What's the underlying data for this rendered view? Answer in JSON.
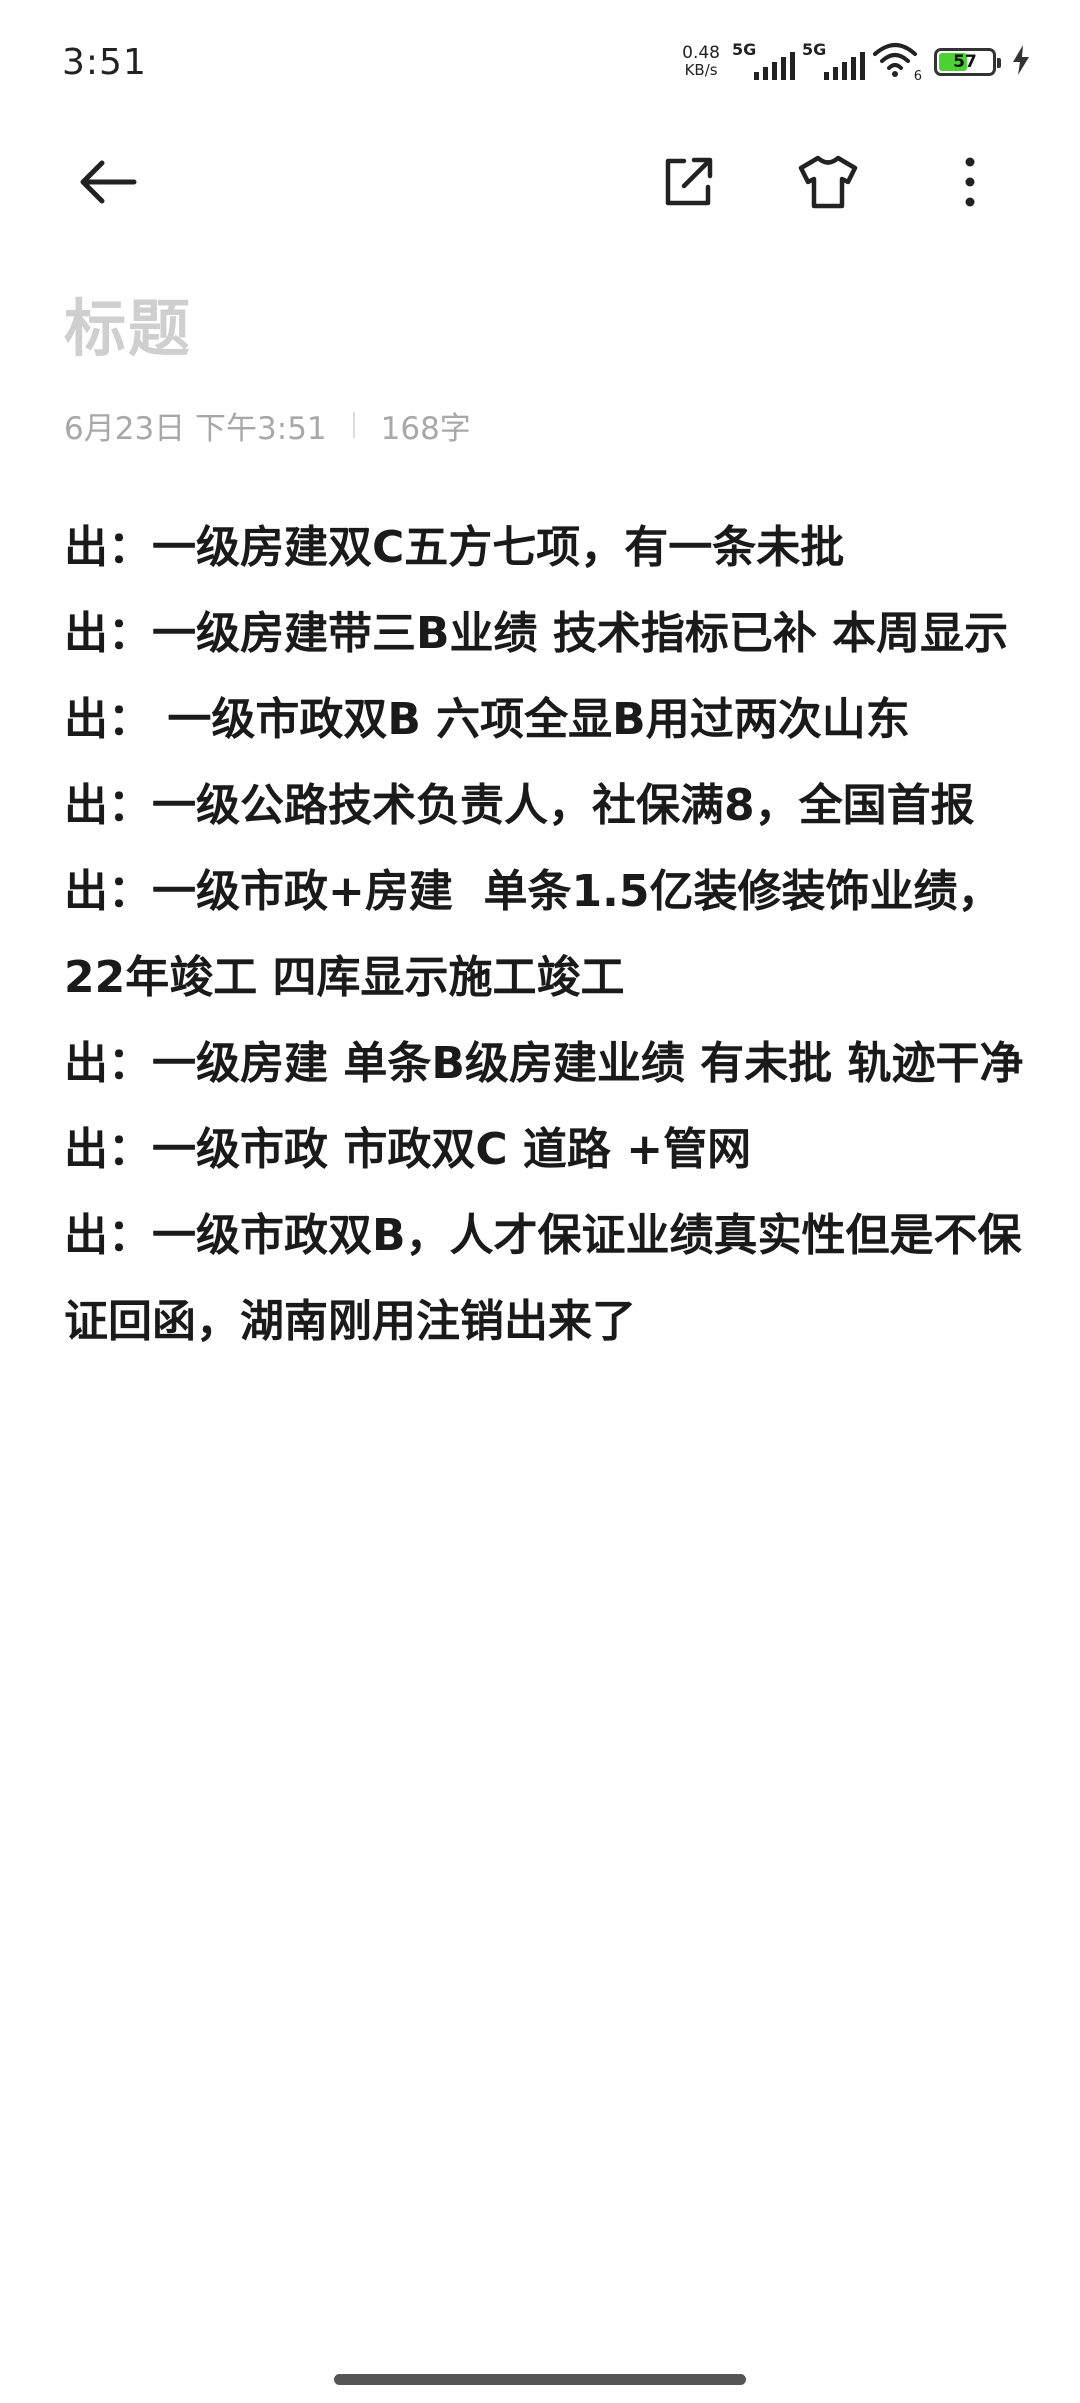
{
  "status_bar": {
    "time": "3:51",
    "net_speed_value": "0.48",
    "net_speed_unit": "KB/s",
    "signal1_label": "5G",
    "signal2_label": "5G",
    "wifi_label": "6",
    "battery_level": "57",
    "battery_percent": 57,
    "icons": [
      "signal-5g-icon",
      "signal-5g-icon",
      "wifi-icon",
      "battery-icon",
      "charging-icon"
    ],
    "battery_color": "#4cd137"
  },
  "toolbar": {
    "icons": [
      "back-arrow-icon",
      "share-export-icon",
      "tshirt-theme-icon",
      "more-vertical-icon"
    ]
  },
  "note": {
    "title_placeholder": "标题",
    "date": "6月23日 下午3:51",
    "char_count": "168字",
    "lines": [
      "出：一级房建双C五方七项，有一条未批",
      "出：一级房建带三B业绩 技术指标已补 本周显示",
      "出： 一级市政双B 六项全显B用过两次山东",
      "出：一级公路技术负责人，社保满8，全国首报",
      "出：一级市政+房建  单条1.5亿装修装饰业绩，22年竣工 四库显示施工竣工",
      "出：一级房建 单条B级房建业绩 有未批 轨迹干净",
      "出：一级市政 市政双C 道路 +管网",
      "出：一级市政双B，人才保证业绩真实性但是不保证回函，湖南刚用注销出来了"
    ]
  }
}
